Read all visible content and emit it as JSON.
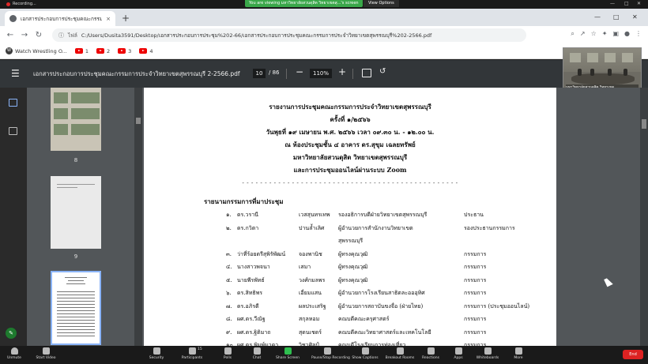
{
  "zoom_top": {
    "recording": "Recording...",
    "viewing_banner": "You are viewing มหาวิทยาลัยสวนดุสิต วิทยาเขตสุ...'s screen",
    "view_options": "View Options",
    "win_min": "—",
    "win_max": "□",
    "win_close": "✕"
  },
  "browser": {
    "tab_title": "เอกสารประกอบการประชุมคณะกรรมการ",
    "tab_close": "×",
    "new_tab": "+",
    "ctrl_min": "—",
    "ctrl_max": "□",
    "ctrl_close": "✕",
    "back": "←",
    "forward": "→",
    "reload": "↻",
    "omni_icon": "ⓘ",
    "omni_file_label": "ไฟล์",
    "url": "C:/Users/Dusita3591/Desktop/เอกสารประกอบการประชุม%202-66/เอกสารประกอบการประชุมคณะกรรมการประจำวิทยาเขตสุพรรณบุรี%202-2566.pdf",
    "toolbar_icons": [
      "⌕",
      "↗",
      "☆",
      "✦",
      "▣",
      "●",
      "⋮"
    ]
  },
  "bookmarks": [
    {
      "label": "Watch Wrestling O...",
      "icon": "wordpress-icon"
    },
    {
      "label": "1",
      "icon": "youtube-icon"
    },
    {
      "label": "2",
      "icon": "youtube-icon"
    },
    {
      "label": "3",
      "icon": "youtube-icon"
    },
    {
      "label": "4",
      "icon": "youtube-icon"
    }
  ],
  "pdf_toolbar": {
    "menu": "☰",
    "title": "เอกสารประกอบการประชุมคณะกรรมการประจำวิทยาเขตสุพรรณบุรี 2-2566.pdf",
    "current_page": "10",
    "total_pages": "/ 86",
    "zoom_minus": "−",
    "zoom": "110%",
    "zoom_plus": "+",
    "rotate": "↺"
  },
  "video": {
    "caption": "มหาวิทยาลัยสวนดุสิต วิทยาเขต..."
  },
  "thumbnails": [
    {
      "page": "8"
    },
    {
      "page": "9"
    },
    {
      "page": "10"
    }
  ],
  "sidebar": {
    "fab": "✎"
  },
  "document": {
    "header_lines": [
      "รายงานการประชุมคณะกรรมการประจำวิทยาเขตสุพรรณบุรี",
      "ครั้งที่ ๑/๒๕๖๖",
      "วันพุธที่ ๑๙ เมษายน พ.ศ. ๒๕๖๖ เวลา ๐๙.๓๐ น. - ๑๒.๐๐ น.",
      "ณ ห้องประชุมชั้น ๔ อาคาร ดร.สุขุม เฉลยทรัพย์",
      "มหาวิทยาลัยสวนดุสิต วิทยาเขตสุพรรณบุรี",
      "และการประชุมออนไลน์ผ่านระบบ Zoom"
    ],
    "divider": "- - - - - - - - - - - - - - - - - - - - - - - - - - - - - - - - - - - - - - - - - - - - - - - -",
    "section_title": "รายนามกรรมการที่มาประชุม",
    "members": [
      {
        "no": "๑.",
        "name": "ดร.วรานี",
        "surname": "เวสสุนทรเทพ",
        "position": "รองอธิการบดีฝ่ายวิทยาเขตสุพรรณบุรี",
        "role": "ประธาน"
      },
      {
        "no": "๒.",
        "name": "ดร.กวิตา",
        "surname": "ปานล้ำเลิศ",
        "position": "ผู้อำนวยการสำนักงานวิทยาเขต",
        "role": "รองประธานกรรมการ"
      },
      {
        "no": "",
        "name": "",
        "surname": "",
        "position": "สุพรรณบุรี",
        "role": ""
      },
      {
        "no": "๓.",
        "name": "ว่าที่ร้อยตรีสุพิรัพัฒน์",
        "surname": "จองพานิช",
        "position": "ผู้ทรงคุณวุฒิ",
        "role": "กรรมการ"
      },
      {
        "no": "๔.",
        "name": "นางสาวพจนา",
        "surname": "เสมา",
        "position": "ผู้ทรงคุณวุฒิ",
        "role": "กรรมการ"
      },
      {
        "no": "๕.",
        "name": "นายพีรพัทธ์",
        "surname": "วงศ์กมลพร",
        "position": "ผู้ทรงคุณวุฒิ",
        "role": "กรรมการ"
      },
      {
        "no": "๖.",
        "name": "ดร.สิทธิพร",
        "surname": "เอี่ยมแสน",
        "position": "ผู้อำนวยการโรงเรียนสาธิตละอออุทิศ",
        "role": "กรรมการ"
      },
      {
        "no": "๗.",
        "name": "ดร.อภิรดี",
        "surname": "ผลประเสริฐ",
        "position": "ผู้อำนวยการสถาบันขงจื่อ (ฝ่ายไทย)",
        "role": "กรรมการ (ประชุมออนไลน์)"
      },
      {
        "no": "๘.",
        "name": "ผศ.ดร.วีณัฐ",
        "surname": "สกุลหอม",
        "position": "คณบดีคณะครุศาสตร์",
        "role": "กรรมการ"
      },
      {
        "no": "๙.",
        "name": "ผศ.ดร.ฐิติมาถ",
        "surname": "สุดนเชดร์",
        "position": "คณบดีคณะวิทยาศาสตร์และเทคโนโลยี",
        "role": "กรรมการ"
      },
      {
        "no": "๑๐.",
        "name": "ผศ.ดร.พิมพ์มาดา",
        "surname": "วิชาศิลป์",
        "position": "คณบดีโรงเรียนการท่องเที่ยว",
        "role": "กรรมการ"
      }
    ]
  },
  "zoom_bar": {
    "items": [
      {
        "label": "Unmute",
        "icon": "microphone-muted-icon",
        "cls": "unmute"
      },
      {
        "label": "Start Video",
        "icon": "video-camera-icon",
        "cls": ""
      },
      {
        "label": "Security",
        "icon": "shield-icon",
        "cls": ""
      },
      {
        "label": "Participants",
        "icon": "participants-icon",
        "cls": ""
      },
      {
        "label": "Polls",
        "icon": "polls-icon",
        "cls": ""
      },
      {
        "label": "Chat",
        "icon": "chat-icon",
        "cls": ""
      },
      {
        "label": "Share Screen",
        "icon": "share-screen-icon",
        "cls": "share"
      },
      {
        "label": "Pause/Stop Recording",
        "icon": "recording-icon",
        "cls": ""
      },
      {
        "label": "Show Captions",
        "icon": "captions-icon",
        "cls": ""
      },
      {
        "label": "Breakout Rooms",
        "icon": "breakout-rooms-icon",
        "cls": ""
      },
      {
        "label": "Reactions",
        "icon": "reactions-icon",
        "cls": ""
      },
      {
        "label": "Apps",
        "icon": "apps-icon",
        "cls": ""
      },
      {
        "label": "Whiteboards",
        "icon": "whiteboards-icon",
        "cls": ""
      },
      {
        "label": "More",
        "icon": "more-icon",
        "cls": ""
      }
    ],
    "participants_count": "15",
    "end_label": "End"
  }
}
